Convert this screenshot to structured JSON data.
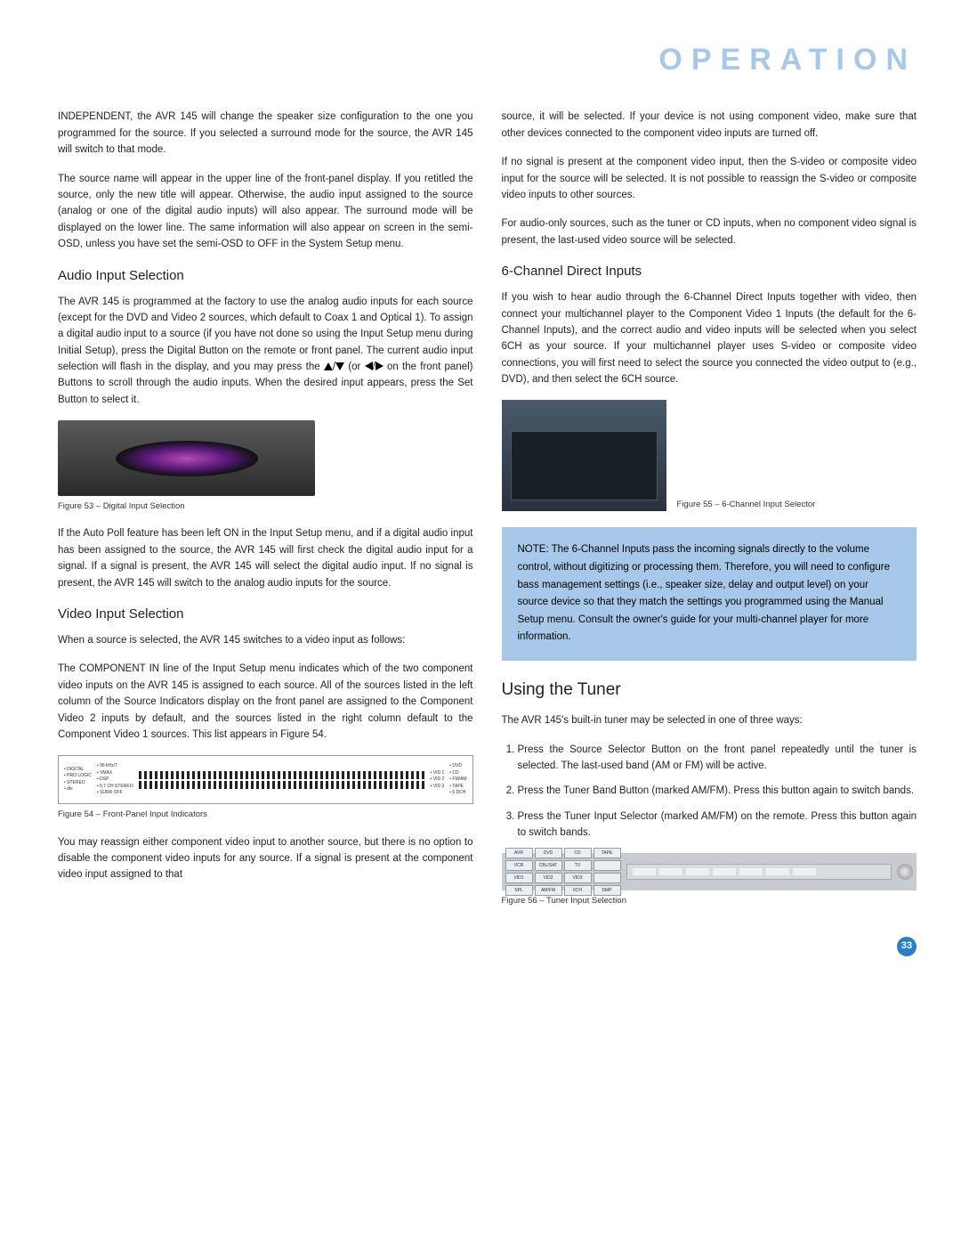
{
  "title": "OPERATION",
  "left": {
    "p1": "INDEPENDENT, the AVR 145 will change the speaker size configuration to the one you programmed for the source. If you selected a surround mode for the source, the AVR 145 will switch to that mode.",
    "p2": "The source name will appear in the upper line of the front-panel display. If you retitled the source, only the new title will appear. Otherwise, the audio input assigned to the source (analog or one of the digital audio inputs) will also appear. The surround mode will be displayed on the lower line. The same information will also appear on screen in the semi-OSD, unless you have set the semi-OSD to OFF in the System Setup menu.",
    "h_audio": "Audio Input Selection",
    "p3a": "The AVR 145 is programmed at the factory to use the analog audio inputs for each source (except for the DVD and Video 2 sources, which default to Coax 1 and Optical 1). To assign a digital audio input to a source (if you have not done so using the Input Setup menu during Initial Setup), press the Digital Button on the remote or front panel. The current audio input selection will flash in the display, and you may press the ",
    "p3b": " (or ",
    "p3c": " on the front panel) Buttons to scroll through the audio inputs. When the desired input appears, press the Set Button to select it.",
    "fig53": "Figure 53 – Digital Input Selection",
    "p4": "If the Auto Poll feature has been left ON in the Input Setup menu, and if a digital audio input has been assigned to the source, the AVR 145 will first check the digital audio input for a signal. If a signal is present, the AVR 145 will select the digital audio input. If no signal is present, the AVR 145 will switch to the analog audio inputs for the source.",
    "h_video": "Video Input Selection",
    "p5": "When a source is selected, the AVR 145 switches to a video input as follows:",
    "p6": "The COMPONENT IN line of the Input Setup menu indicates which of the two component video inputs on the AVR 145 is assigned to each source. All of the sources listed in the left column of the Source Indicators display on the front panel are assigned to the Component Video 2 inputs by default, and the sources listed in the right column default to the Component Video 1 sources. This list appears in Figure 54.",
    "fig54": "Figure 54 – Front-Panel Input Indicators",
    "p7": "You may reassign either component video input to another source, but there is no option to disable the component video inputs for any source. If a signal is present at the component video input assigned to that"
  },
  "right": {
    "p1": "source, it will be selected. If your device is not using component video, make sure that other devices connected to the component video inputs are turned off.",
    "p2": "If no signal is present at the component video input, then the S-video or composite video input for the source will be selected. It is not possible to reassign the S-video or composite video inputs to other sources.",
    "p3": "For audio-only sources, such as the tuner or CD inputs, when no component video signal is present, the last-used video source will be selected.",
    "h_6ch": "6-Channel Direct Inputs",
    "p4": "If you wish to hear audio through the 6-Channel Direct Inputs together with video, then connect your multichannel player to the Component Video 1 Inputs (the default for the 6-Channel Inputs), and the correct audio and video inputs will be selected when you select 6CH as your source. If your multichannel player uses S-video or composite video connections, you will first need to select the source you connected the video output to (e.g., DVD), and then select the 6CH source.",
    "fig55": "Figure 55 – 6-Channel Input Selector",
    "note_label": "NOTE:",
    "note": " The 6-Channel Inputs pass the incoming signals directly to the volume control, without digitizing or processing them. Therefore, you will need to configure bass management settings (i.e., speaker size, delay and output level) on your source device so that they match the settings you programmed using the Manual Setup menu. Consult the owner's guide for your multi-channel player for more information.",
    "h_tuner": "Using the Tuner",
    "p5": "The AVR 145's built-in tuner may be selected in one of three ways:",
    "li1": "Press the Source Selector Button on the front panel repeatedly until the tuner is selected. The last-used band (AM or FM) will be active.",
    "li2": "Press the Tuner Band Button (marked AM/FM). Press this button again to switch bands.",
    "li3": "Press the Tuner Input Selector (marked AM/FM) on the remote. Press this button again to switch bands.",
    "fig56": "Figure 56 – Tuner Input Selection",
    "fig56_btns": [
      "AVR",
      "DVD",
      "CD",
      "TAPE",
      "VCR",
      "CBL/SAT",
      "TV",
      "",
      "VID1",
      "VID2",
      "VID3",
      "",
      "SPL",
      "AM/FM",
      "6CH",
      "DMP"
    ]
  },
  "page": "33"
}
